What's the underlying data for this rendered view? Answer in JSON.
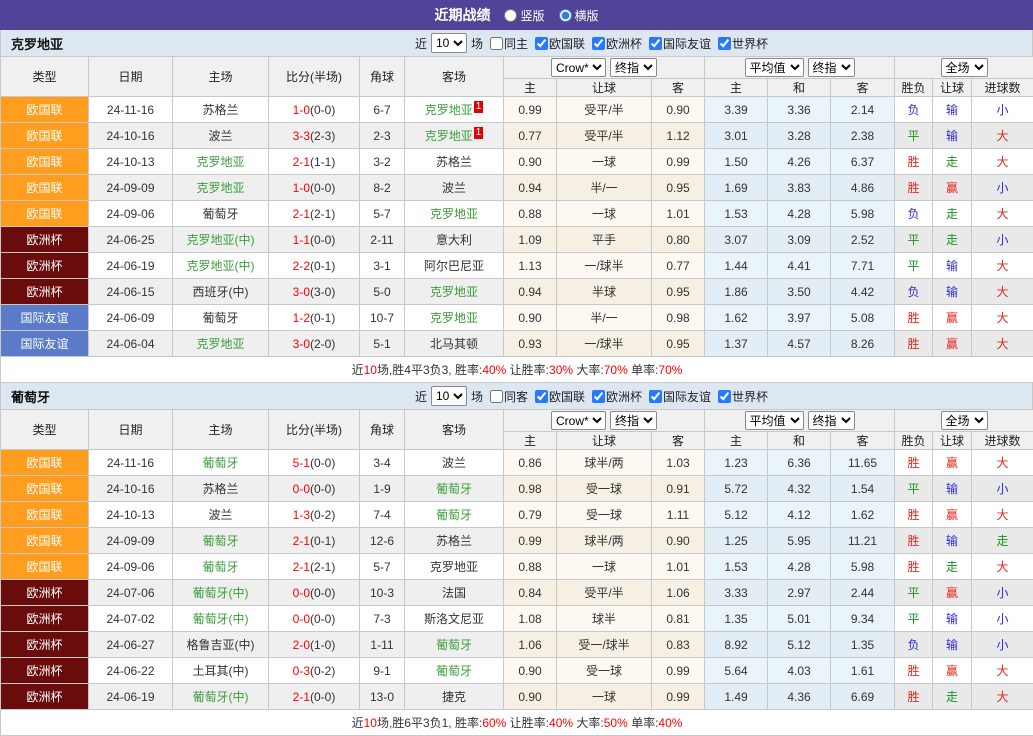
{
  "title_bar": {
    "title": "近期战绩",
    "layout_options": [
      {
        "label": "竖版",
        "selected": false
      },
      {
        "label": "横版",
        "selected": true
      }
    ]
  },
  "colors": {
    "accent_purple": "#514397",
    "comp_colors": {
      "欧国联": "#ff9d1e",
      "欧洲杯": "#6b0c0c",
      "国际友谊": "#5b7bc8"
    },
    "result_colors": {
      "胜": "#e8251c",
      "赢": "#e8251c",
      "大": "#e8251c",
      "平": "#17941c",
      "走": "#17941c",
      "负": "#2b2bd5",
      "输": "#2b2bd5",
      "小": "#2b2bd5"
    },
    "team_green": "#3a9e3a",
    "score_red": "#ff0000"
  },
  "table_headers": {
    "left_cols": [
      "类型",
      "日期",
      "主场",
      "比分(半场)",
      "角球",
      "客场"
    ],
    "group1_cols": [
      "主",
      "让球",
      "客"
    ],
    "group2_cols": [
      "主",
      "和",
      "客"
    ],
    "group3_cols": [
      "胜负",
      "让球",
      "进球数"
    ],
    "dropdowns": {
      "odds_source": "Crow*",
      "odds_stage": "终指",
      "avg_source": "平均值",
      "avg_stage": "终指",
      "scope": "全场"
    }
  },
  "sections": [
    {
      "team": "克罗地亚",
      "filter": {
        "near_label": "近",
        "count": "10",
        "games_label": "场",
        "same_label": "同主",
        "same_checked": false,
        "competitions": [
          {
            "label": "欧国联",
            "checked": true
          },
          {
            "label": "欧洲杯",
            "checked": true
          },
          {
            "label": "国际友谊",
            "checked": true
          },
          {
            "label": "世界杯",
            "checked": true
          }
        ]
      },
      "rows": [
        {
          "comp": "欧国联",
          "date": "24-11-16",
          "home": {
            "name": "苏格兰",
            "green": false
          },
          "score": "1-0",
          "half": "(0-0)",
          "corner": "6-7",
          "away": {
            "name": "克罗地亚",
            "green": true,
            "red_card": "1"
          },
          "odds": [
            "0.99",
            "受平/半",
            "0.90"
          ],
          "avg": [
            "3.39",
            "3.36",
            "2.14"
          ],
          "results": [
            "负",
            "输",
            "小"
          ]
        },
        {
          "comp": "欧国联",
          "date": "24-10-16",
          "home": {
            "name": "波兰",
            "green": false
          },
          "score": "3-3",
          "half": "(2-3)",
          "corner": "2-3",
          "away": {
            "name": "克罗地亚",
            "green": true,
            "red_card": "1"
          },
          "odds": [
            "0.77",
            "受平/半",
            "1.12"
          ],
          "avg": [
            "3.01",
            "3.28",
            "2.38"
          ],
          "results": [
            "平",
            "输",
            "大"
          ]
        },
        {
          "comp": "欧国联",
          "date": "24-10-13",
          "home": {
            "name": "克罗地亚",
            "green": true
          },
          "score": "2-1",
          "half": "(1-1)",
          "corner": "3-2",
          "away": {
            "name": "苏格兰",
            "green": false
          },
          "odds": [
            "0.90",
            "一球",
            "0.99"
          ],
          "avg": [
            "1.50",
            "4.26",
            "6.37"
          ],
          "results": [
            "胜",
            "走",
            "大"
          ]
        },
        {
          "comp": "欧国联",
          "date": "24-09-09",
          "home": {
            "name": "克罗地亚",
            "green": true
          },
          "score": "1-0",
          "half": "(0-0)",
          "corner": "8-2",
          "away": {
            "name": "波兰",
            "green": false
          },
          "odds": [
            "0.94",
            "半/一",
            "0.95"
          ],
          "avg": [
            "1.69",
            "3.83",
            "4.86"
          ],
          "results": [
            "胜",
            "赢",
            "小"
          ]
        },
        {
          "comp": "欧国联",
          "date": "24-09-06",
          "home": {
            "name": "葡萄牙",
            "green": false
          },
          "score": "2-1",
          "half": "(2-1)",
          "corner": "5-7",
          "away": {
            "name": "克罗地亚",
            "green": true
          },
          "odds": [
            "0.88",
            "一球",
            "1.01"
          ],
          "avg": [
            "1.53",
            "4.28",
            "5.98"
          ],
          "results": [
            "负",
            "走",
            "大"
          ]
        },
        {
          "comp": "欧洲杯",
          "date": "24-06-25",
          "home": {
            "name": "克罗地亚(中)",
            "green": true
          },
          "score": "1-1",
          "half": "(0-0)",
          "corner": "2-11",
          "away": {
            "name": "意大利",
            "green": false
          },
          "odds": [
            "1.09",
            "平手",
            "0.80"
          ],
          "avg": [
            "3.07",
            "3.09",
            "2.52"
          ],
          "results": [
            "平",
            "走",
            "小"
          ]
        },
        {
          "comp": "欧洲杯",
          "date": "24-06-19",
          "home": {
            "name": "克罗地亚(中)",
            "green": true
          },
          "score": "2-2",
          "half": "(0-1)",
          "corner": "3-1",
          "away": {
            "name": "阿尔巴尼亚",
            "green": false
          },
          "odds": [
            "1.13",
            "一/球半",
            "0.77"
          ],
          "avg": [
            "1.44",
            "4.41",
            "7.71"
          ],
          "results": [
            "平",
            "输",
            "大"
          ]
        },
        {
          "comp": "欧洲杯",
          "date": "24-06-15",
          "home": {
            "name": "西班牙(中)",
            "green": false
          },
          "score": "3-0",
          "half": "(3-0)",
          "corner": "5-0",
          "away": {
            "name": "克罗地亚",
            "green": true
          },
          "odds": [
            "0.94",
            "半球",
            "0.95"
          ],
          "avg": [
            "1.86",
            "3.50",
            "4.42"
          ],
          "results": [
            "负",
            "输",
            "大"
          ]
        },
        {
          "comp": "国际友谊",
          "date": "24-06-09",
          "home": {
            "name": "葡萄牙",
            "green": false
          },
          "score": "1-2",
          "half": "(0-1)",
          "corner": "10-7",
          "away": {
            "name": "克罗地亚",
            "green": true
          },
          "odds": [
            "0.90",
            "半/一",
            "0.98"
          ],
          "avg": [
            "1.62",
            "3.97",
            "5.08"
          ],
          "results": [
            "胜",
            "赢",
            "大"
          ]
        },
        {
          "comp": "国际友谊",
          "date": "24-06-04",
          "home": {
            "name": "克罗地亚",
            "green": true
          },
          "score": "3-0",
          "half": "(2-0)",
          "corner": "5-1",
          "away": {
            "name": "北马其顿",
            "green": false
          },
          "odds": [
            "0.93",
            "一/球半",
            "0.95"
          ],
          "avg": [
            "1.37",
            "4.57",
            "8.26"
          ],
          "results": [
            "胜",
            "赢",
            "大"
          ]
        }
      ],
      "summary": [
        {
          "text": "近",
          "red": false
        },
        {
          "text": "10",
          "red": true
        },
        {
          "text": "场,胜4平3负3, 胜率:",
          "red": false
        },
        {
          "text": "40%",
          "red": true
        },
        {
          "text": " 让胜率:",
          "red": false
        },
        {
          "text": "30%",
          "red": true
        },
        {
          "text": " 大率:",
          "red": false
        },
        {
          "text": "70%",
          "red": true
        },
        {
          "text": " 单率:",
          "red": false
        },
        {
          "text": "70%",
          "red": true
        }
      ]
    },
    {
      "team": "葡萄牙",
      "filter": {
        "near_label": "近",
        "count": "10",
        "games_label": "场",
        "same_label": "同客",
        "same_checked": false,
        "competitions": [
          {
            "label": "欧国联",
            "checked": true
          },
          {
            "label": "欧洲杯",
            "checked": true
          },
          {
            "label": "国际友谊",
            "checked": true
          },
          {
            "label": "世界杯",
            "checked": true
          }
        ]
      },
      "rows": [
        {
          "comp": "欧国联",
          "date": "24-11-16",
          "home": {
            "name": "葡萄牙",
            "green": true
          },
          "score": "5-1",
          "half": "(0-0)",
          "corner": "3-4",
          "away": {
            "name": "波兰",
            "green": false
          },
          "odds": [
            "0.86",
            "球半/两",
            "1.03"
          ],
          "avg": [
            "1.23",
            "6.36",
            "11.65"
          ],
          "results": [
            "胜",
            "赢",
            "大"
          ]
        },
        {
          "comp": "欧国联",
          "date": "24-10-16",
          "home": {
            "name": "苏格兰",
            "green": false
          },
          "score": "0-0",
          "half": "(0-0)",
          "corner": "1-9",
          "away": {
            "name": "葡萄牙",
            "green": true
          },
          "odds": [
            "0.98",
            "受一球",
            "0.91"
          ],
          "avg": [
            "5.72",
            "4.32",
            "1.54"
          ],
          "results": [
            "平",
            "输",
            "小"
          ]
        },
        {
          "comp": "欧国联",
          "date": "24-10-13",
          "home": {
            "name": "波兰",
            "green": false
          },
          "score": "1-3",
          "half": "(0-2)",
          "corner": "7-4",
          "away": {
            "name": "葡萄牙",
            "green": true
          },
          "odds": [
            "0.79",
            "受一球",
            "1.11"
          ],
          "avg": [
            "5.12",
            "4.12",
            "1.62"
          ],
          "results": [
            "胜",
            "赢",
            "大"
          ]
        },
        {
          "comp": "欧国联",
          "date": "24-09-09",
          "home": {
            "name": "葡萄牙",
            "green": true
          },
          "score": "2-1",
          "half": "(0-1)",
          "corner": "12-6",
          "away": {
            "name": "苏格兰",
            "green": false
          },
          "odds": [
            "0.99",
            "球半/两",
            "0.90"
          ],
          "avg": [
            "1.25",
            "5.95",
            "11.21"
          ],
          "results": [
            "胜",
            "输",
            "走"
          ]
        },
        {
          "comp": "欧国联",
          "date": "24-09-06",
          "home": {
            "name": "葡萄牙",
            "green": true
          },
          "score": "2-1",
          "half": "(2-1)",
          "corner": "5-7",
          "away": {
            "name": "克罗地亚",
            "green": false
          },
          "odds": [
            "0.88",
            "一球",
            "1.01"
          ],
          "avg": [
            "1.53",
            "4.28",
            "5.98"
          ],
          "results": [
            "胜",
            "走",
            "大"
          ]
        },
        {
          "comp": "欧洲杯",
          "date": "24-07-06",
          "home": {
            "name": "葡萄牙(中)",
            "green": true
          },
          "score": "0-0",
          "half": "(0-0)",
          "corner": "10-3",
          "away": {
            "name": "法国",
            "green": false
          },
          "odds": [
            "0.84",
            "受平/半",
            "1.06"
          ],
          "avg": [
            "3.33",
            "2.97",
            "2.44"
          ],
          "results": [
            "平",
            "赢",
            "小"
          ]
        },
        {
          "comp": "欧洲杯",
          "date": "24-07-02",
          "home": {
            "name": "葡萄牙(中)",
            "green": true
          },
          "score": "0-0",
          "half": "(0-0)",
          "corner": "7-3",
          "away": {
            "name": "斯洛文尼亚",
            "green": false
          },
          "odds": [
            "1.08",
            "球半",
            "0.81"
          ],
          "avg": [
            "1.35",
            "5.01",
            "9.34"
          ],
          "results": [
            "平",
            "输",
            "小"
          ]
        },
        {
          "comp": "欧洲杯",
          "date": "24-06-27",
          "home": {
            "name": "格鲁吉亚(中)",
            "green": false
          },
          "score": "2-0",
          "half": "(1-0)",
          "corner": "1-11",
          "away": {
            "name": "葡萄牙",
            "green": true
          },
          "odds": [
            "1.06",
            "受一/球半",
            "0.83"
          ],
          "avg": [
            "8.92",
            "5.12",
            "1.35"
          ],
          "results": [
            "负",
            "输",
            "小"
          ]
        },
        {
          "comp": "欧洲杯",
          "date": "24-06-22",
          "home": {
            "name": "土耳其(中)",
            "green": false
          },
          "score": "0-3",
          "half": "(0-2)",
          "corner": "9-1",
          "away": {
            "name": "葡萄牙",
            "green": true
          },
          "odds": [
            "0.90",
            "受一球",
            "0.99"
          ],
          "avg": [
            "5.64",
            "4.03",
            "1.61"
          ],
          "results": [
            "胜",
            "赢",
            "大"
          ]
        },
        {
          "comp": "欧洲杯",
          "date": "24-06-19",
          "home": {
            "name": "葡萄牙(中)",
            "green": true
          },
          "score": "2-1",
          "half": "(0-0)",
          "corner": "13-0",
          "away": {
            "name": "捷克",
            "green": false
          },
          "odds": [
            "0.90",
            "一球",
            "0.99"
          ],
          "avg": [
            "1.49",
            "4.36",
            "6.69"
          ],
          "results": [
            "胜",
            "走",
            "大"
          ]
        }
      ],
      "summary": [
        {
          "text": "近",
          "red": false
        },
        {
          "text": "10",
          "red": true
        },
        {
          "text": "场,胜6平3负1, 胜率:",
          "red": false
        },
        {
          "text": "60%",
          "red": true
        },
        {
          "text": " 让胜率:",
          "red": false
        },
        {
          "text": "40%",
          "red": true
        },
        {
          "text": " 大率:",
          "red": false
        },
        {
          "text": "50%",
          "red": true
        },
        {
          "text": " 单率:",
          "red": false
        },
        {
          "text": "40%",
          "red": true
        }
      ]
    }
  ]
}
